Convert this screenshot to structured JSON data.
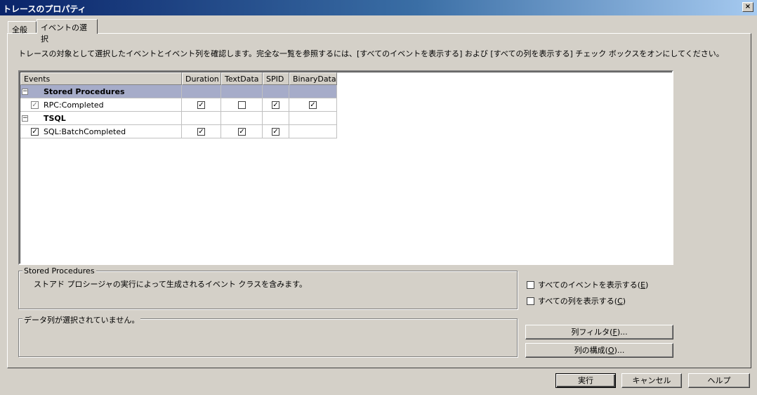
{
  "window": {
    "title": "トレースのプロパティ",
    "close_glyph": "×"
  },
  "tabs": [
    {
      "label": "全般"
    },
    {
      "label": "イベントの選択"
    }
  ],
  "instruction": "トレースの対象として選択したイベントとイベント列を確認します。完全な一覧を参照するには、[すべてのイベントを表示する] および [すべての列を表示する] チェック ボックスをオンにしてください。",
  "grid": {
    "columns": [
      "Events",
      "Duration",
      "TextData",
      "SPID",
      "BinaryData"
    ],
    "rows": [
      {
        "type": "group",
        "label": "Stored Procedures",
        "expander": "−",
        "selected": true
      },
      {
        "type": "event",
        "label": "RPC:Completed",
        "checked": true,
        "disabled": true,
        "columns": {
          "Duration": true,
          "TextData": false,
          "SPID": true,
          "BinaryData": true
        }
      },
      {
        "type": "group",
        "label": "TSQL",
        "expander": "−",
        "selected": false
      },
      {
        "type": "event",
        "label": "SQL:BatchCompleted",
        "checked": true,
        "disabled": false,
        "columns": {
          "Duration": true,
          "TextData": true,
          "SPID": true,
          "BinaryData": null
        }
      }
    ]
  },
  "description_box": {
    "title": "Stored Procedures",
    "text": "ストアド プロシージャの実行によって生成されるイベント クラスを含みます。"
  },
  "column_box": {
    "title": "データ列が選択されていません。"
  },
  "options": {
    "show_all_events": {
      "label_pre": "すべてのイベントを表示する(",
      "accel": "E",
      "label_post": ")",
      "checked": false
    },
    "show_all_columns": {
      "label_pre": "すべての列を表示する(",
      "accel": "C",
      "label_post": ")",
      "checked": false
    }
  },
  "side_buttons": {
    "column_filter": {
      "label_pre": "列フィルタ(",
      "accel": "F",
      "label_post": ")..."
    },
    "organize_columns": {
      "label_pre": "列の構成(",
      "accel": "O",
      "label_post": ")..."
    }
  },
  "footer_buttons": {
    "run": "実行",
    "cancel": "キャンセル",
    "help": "ヘルプ"
  },
  "check_glyph": "✓"
}
